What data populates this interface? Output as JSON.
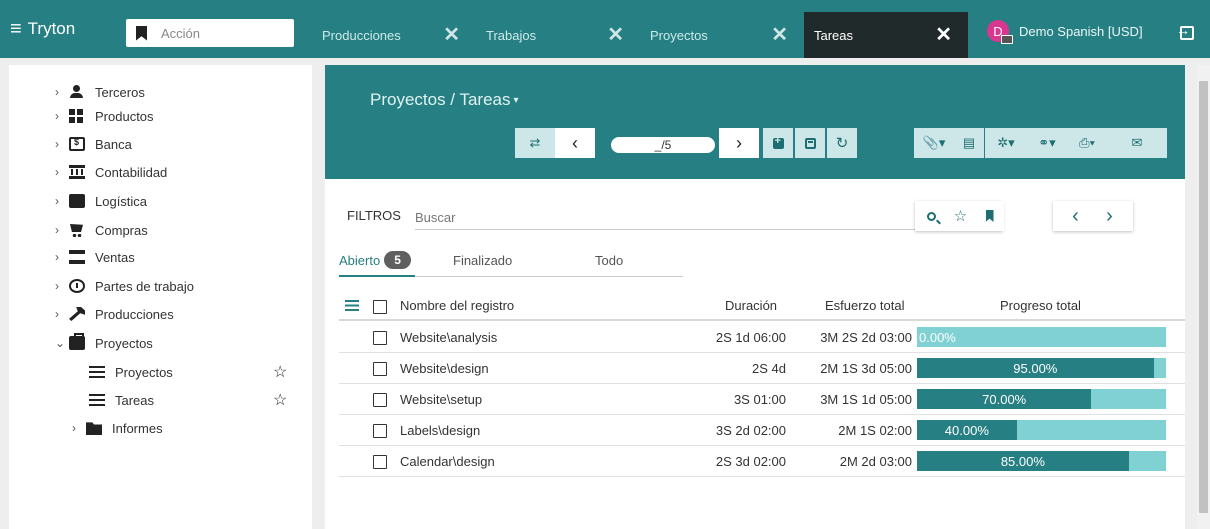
{
  "app": {
    "brand": "Tryton",
    "action_placeholder": "Acción"
  },
  "tabs": [
    {
      "label": "Producciones"
    },
    {
      "label": "Trabajos"
    },
    {
      "label": "Proyectos"
    },
    {
      "label": "Tareas",
      "active": true
    }
  ],
  "company": {
    "avatar": "D",
    "name": "Demo Spanish [USD]"
  },
  "sidebar": {
    "items": [
      {
        "label": "Terceros",
        "icon": "person-icon"
      },
      {
        "label": "Productos",
        "icon": "grid-icon"
      },
      {
        "label": "Banca",
        "icon": "bank-icon"
      },
      {
        "label": "Contabilidad",
        "icon": "temple-icon"
      },
      {
        "label": "Logística",
        "icon": "truck-icon"
      },
      {
        "label": "Compras",
        "icon": "cart-icon"
      },
      {
        "label": "Ventas",
        "icon": "store-icon"
      },
      {
        "label": "Partes de trabajo",
        "icon": "timer-icon"
      },
      {
        "label": "Producciones",
        "icon": "wrench-icon"
      },
      {
        "label": "Proyectos",
        "icon": "briefcase-icon",
        "expanded": true
      },
      {
        "label": "Proyectos",
        "icon": "list-icon",
        "child": true
      },
      {
        "label": "Tareas",
        "icon": "list-icon",
        "child": true
      },
      {
        "label": "Informes",
        "icon": "folder-icon",
        "child": true
      }
    ]
  },
  "main": {
    "breadcrumb": "Proyectos / Tareas",
    "pager": "_/5",
    "filter_label": "FILTROS",
    "search_placeholder": "Buscar",
    "status_tabs": [
      {
        "label": "Abierto",
        "count": "5"
      },
      {
        "label": "Finalizado"
      },
      {
        "label": "Todo"
      }
    ],
    "columns": {
      "name": "Nombre del registro",
      "duration": "Duración",
      "effort": "Esfuerzo total",
      "progress": "Progreso total"
    },
    "rows": [
      {
        "name": "Website\\analysis",
        "duration": "2S 1d 06:00",
        "effort": "3M 2S 2d 03:00",
        "progress_label": "0.00%",
        "progress": 0.0
      },
      {
        "name": "Website\\design",
        "duration": "2S 4d",
        "effort": "2M 1S 3d 05:00",
        "progress_label": "95.00%",
        "progress": 0.95
      },
      {
        "name": "Website\\setup",
        "duration": "3S 01:00",
        "effort": "3M 1S 1d 05:00",
        "progress_label": "70.00%",
        "progress": 0.7
      },
      {
        "name": "Labels\\design",
        "duration": "3S 2d 02:00",
        "effort": "2M 1S 02:00",
        "progress_label": "40.00%",
        "progress": 0.4
      },
      {
        "name": "Calendar\\design",
        "duration": "2S 3d 02:00",
        "effort": "2M 2d 03:00",
        "progress_label": "85.00%",
        "progress": 0.85
      }
    ]
  },
  "colors": {
    "primary": "#267f82",
    "progress_bg": "#7fd1d4",
    "active_tab": "#202a2b"
  }
}
